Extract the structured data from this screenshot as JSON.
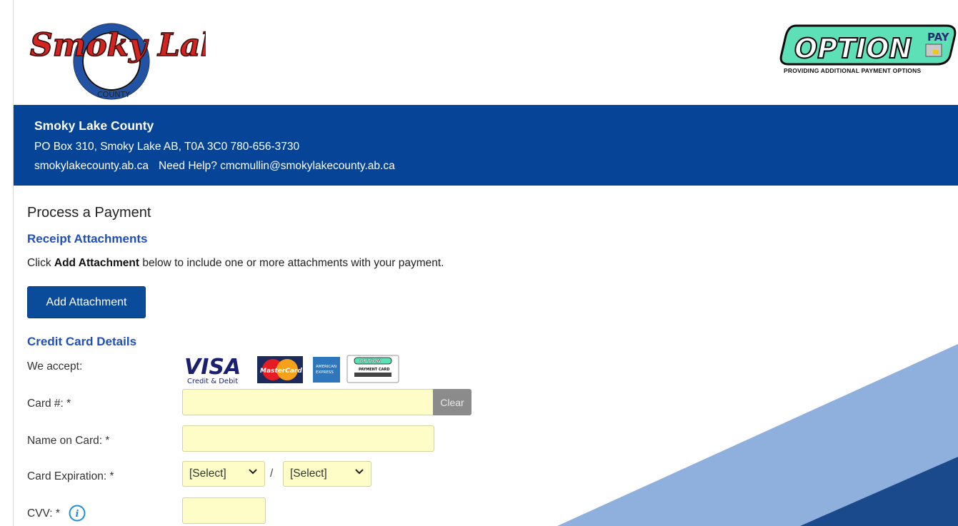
{
  "header": {
    "left_logo_text": "Smoky Lake",
    "left_logo_sub": "COUNTY",
    "right_logo_text": "OPTION",
    "right_logo_badge": "PAY",
    "right_logo_tagline": "PROVIDING ADDITIONAL PAYMENT OPTIONS"
  },
  "org": {
    "name": "Smoky Lake County",
    "address": "PO Box 310, Smoky Lake AB, T0A 3C0   780-656-3730",
    "website": "smokylakecounty.ab.ca",
    "help_text": "Need Help? cmcmullin@smokylakecounty.ab.ca"
  },
  "page": {
    "title": "Process a Payment"
  },
  "attachments": {
    "heading": "Receipt Attachments",
    "intro_prefix": "Click ",
    "intro_bold": "Add Attachment",
    "intro_suffix": " below to include one or more attachments with your payment.",
    "button_label": "Add Attachment"
  },
  "credit_card": {
    "heading": "Credit Card Details",
    "we_accept_label": "We accept:",
    "card_brands": [
      "VISA",
      "MasterCard",
      "AMERICAN EXPRESS",
      "OPTION PAYMENT CARD"
    ],
    "visa_sub": "Credit & Debit",
    "card_number_label": "Card #: *",
    "card_number_value": "",
    "clear_label": "Clear",
    "name_label": "Name on Card: *",
    "name_value": "",
    "expiration_label": "Card Expiration: *",
    "exp_month_selected": "[Select]",
    "exp_year_selected": "[Select]",
    "exp_separator": "/",
    "cvv_label": "CVV: *",
    "cvv_value": ""
  },
  "colors": {
    "band": "#054496",
    "heading_blue": "#1f4fbd",
    "button_blue": "#0a4c9a",
    "field_fill": "#fefcc7",
    "deco_light": "#8fb0dc",
    "deco_dark": "#1b4a8c"
  }
}
